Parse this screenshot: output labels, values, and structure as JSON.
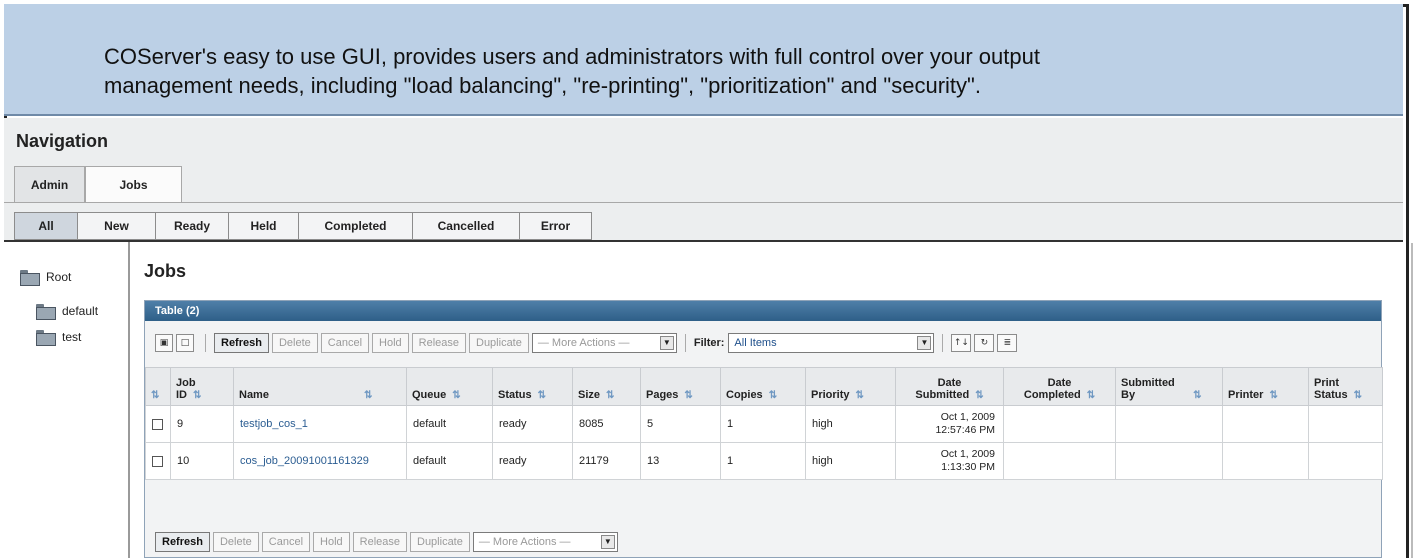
{
  "banner": {
    "text_line1": "COServer's easy to use GUI, provides users and administrators with full control over your output",
    "text_line2": "management needs, including \"load balancing\", \"re-printing\", \"prioritization\" and \"security\"."
  },
  "nav": {
    "title": "Navigation",
    "tabs": [
      {
        "label": "Admin",
        "active": false
      },
      {
        "label": "Jobs",
        "active": true
      }
    ],
    "subtabs": [
      {
        "label": "All",
        "active": true
      },
      {
        "label": "New",
        "active": false
      },
      {
        "label": "Ready",
        "active": false
      },
      {
        "label": "Held",
        "active": false
      },
      {
        "label": "Completed",
        "active": false
      },
      {
        "label": "Cancelled",
        "active": false
      },
      {
        "label": "Error",
        "active": false
      }
    ]
  },
  "tree": {
    "root": "Root",
    "children": [
      "default",
      "test"
    ]
  },
  "main": {
    "title": "Jobs",
    "table_caption": "Table (2)",
    "toolbar": {
      "refresh": "Refresh",
      "delete": "Delete",
      "cancel": "Cancel",
      "hold": "Hold",
      "release": "Release",
      "duplicate": "Duplicate",
      "more_actions": "— More Actions —",
      "filter_label": "Filter:",
      "filter_value": "All Items"
    },
    "columns": {
      "job_id_1": "Job",
      "job_id_2": "ID",
      "name": "Name",
      "queue": "Queue",
      "status": "Status",
      "size": "Size",
      "pages": "Pages",
      "copies": "Copies",
      "priority": "Priority",
      "date_submitted_1": "Date",
      "date_submitted_2": "Submitted",
      "date_completed_1": "Date",
      "date_completed_2": "Completed",
      "submitted_by_1": "Submitted",
      "submitted_by_2": "By",
      "printer": "Printer",
      "print_status_1": "Print",
      "print_status_2": "Status"
    },
    "rows": [
      {
        "id": "9",
        "name": "testjob_cos_1",
        "queue": "default",
        "status": "ready",
        "size": "8085",
        "pages": "5",
        "copies": "1",
        "priority": "high",
        "date_submitted_1": "Oct 1, 2009",
        "date_submitted_2": "12:57:46 PM",
        "date_completed": "",
        "submitted_by": "",
        "printer": "",
        "print_status": ""
      },
      {
        "id": "10",
        "name": "cos_job_20091001161329",
        "queue": "default",
        "status": "ready",
        "size": "21179",
        "pages": "13",
        "copies": "1",
        "priority": "high",
        "date_submitted_1": "Oct 1, 2009",
        "date_submitted_2": "1:13:30 PM",
        "date_completed": "",
        "submitted_by": "",
        "printer": "",
        "print_status": ""
      }
    ]
  },
  "colors": {
    "banner_bg": "#bcd0e6",
    "table_header": "#3a6b93",
    "link": "#2b5d92"
  }
}
